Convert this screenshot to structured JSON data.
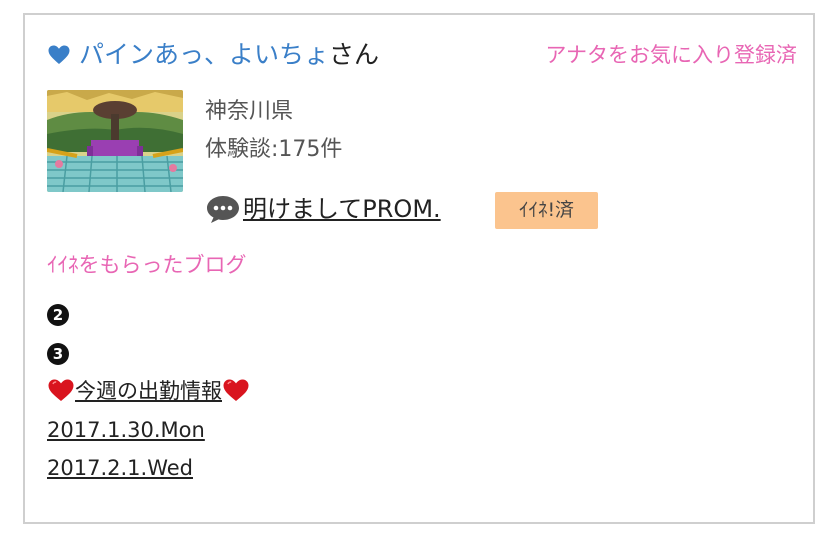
{
  "user": {
    "name": "パインあっ、よいちょ",
    "honorific": "さん",
    "favorite_status": "アナタをお気に入り登録済",
    "prefecture": "神奈川県",
    "experiences": "体験談:175件"
  },
  "latest_blog": {
    "title": "明けましてPROM.",
    "badge": "ｲｲﾈ!済"
  },
  "liked_blogs": {
    "heading": "ｲｲﾈをもらったブログ",
    "items": [
      {
        "marker": "2",
        "text": ""
      },
      {
        "marker": "3",
        "text": ""
      },
      {
        "text": "今週の出勤情報"
      },
      {
        "text": "2017.1.30.Mon"
      },
      {
        "text": "2017.2.1.Wed"
      }
    ]
  },
  "colors": {
    "link_blue": "#3a7fc8",
    "accent_pink": "#e866b4",
    "badge_orange": "#fbc48e",
    "heart_red": "#d9141e"
  },
  "icons": {
    "heart": "blue-heart-icon",
    "speech": "speech-bubble-icon",
    "list_heart": "red-heart-icon"
  }
}
